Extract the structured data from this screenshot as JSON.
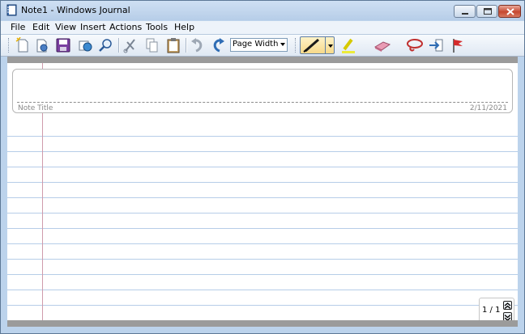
{
  "window": {
    "title": "Note1 - Windows Journal"
  },
  "menu": [
    "File",
    "Edit",
    "View",
    "Insert",
    "Actions",
    "Tools",
    "Help"
  ],
  "toolbar": {
    "zoom_value": "Page Width",
    "buttons": [
      "new-note",
      "open",
      "save",
      "send",
      "find",
      "cut",
      "copy",
      "paste",
      "undo",
      "redo",
      "pen",
      "highlighter",
      "eraser",
      "lasso-select",
      "insert-space",
      "flag"
    ]
  },
  "note": {
    "title_placeholder": "Note Title",
    "date": "2/11/2021"
  },
  "pager": {
    "label": "1 / 1"
  },
  "colors": {
    "rule_line": "#b6cde8",
    "margin_line": "#cf9bab",
    "page_gutter": "#9b9b9b"
  }
}
